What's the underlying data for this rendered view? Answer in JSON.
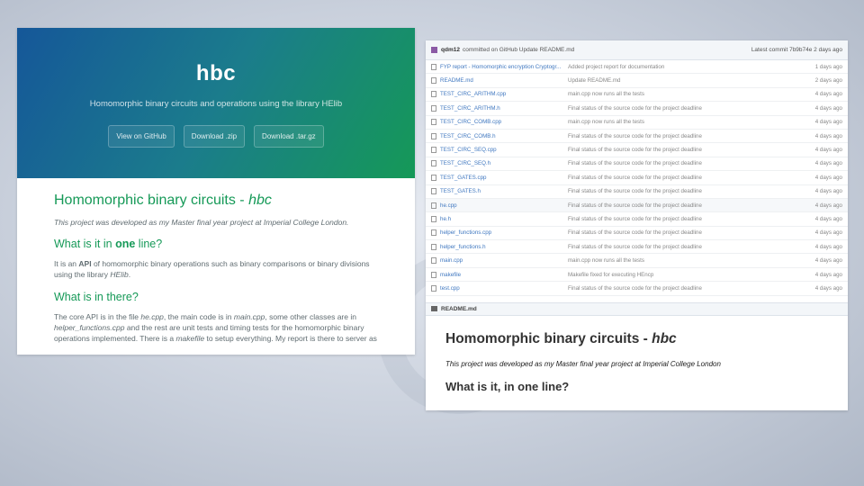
{
  "left": {
    "hero": {
      "title": "hbc",
      "tagline": "Homomorphic binary circuits and operations using the library HElib",
      "buttons": [
        "View on GitHub",
        "Download .zip",
        "Download .tar.gz"
      ]
    },
    "content": {
      "heading_main": "Homomorphic binary circuits - ",
      "heading_main_em": "hbc",
      "intro": "This project was developed as my Master final year project at Imperial College London.",
      "h2_one_pre": "What is it in ",
      "h2_one_bold": "one",
      "h2_one_post": " line?",
      "p1_pre": "It is an ",
      "p1_bold": "API",
      "p1_mid": " of homomorphic binary operations such as binary comparisons or binary divisions using the library ",
      "p1_em": "HElib",
      "p1_end": ".",
      "h2_two": "What is in there?",
      "p2_a": "The core API is in the file ",
      "p2_b": "he.cpp",
      "p2_c": ", the main code is in ",
      "p2_d": "main.cpp",
      "p2_e": ", some other classes are in ",
      "p2_f": "helper_functions.cpp",
      "p2_g": " and the rest are unit tests and timing tests for the homomorphic binary operations implemented. There is a ",
      "p2_h": "makefile",
      "p2_i": " to setup everything. My report is there to server as"
    }
  },
  "right": {
    "commit": {
      "user": "qdm12",
      "text": "committed on GitHub Update README.md",
      "latest": "Latest commit 7b9b74e 2 days ago"
    },
    "files": [
      {
        "name": "FYP report - Homomorphic encryption Cryptogr...",
        "msg": "Added project report for documentation",
        "age": "1 days ago"
      },
      {
        "name": "README.md",
        "msg": "Update README.md",
        "age": "2 days ago"
      },
      {
        "name": "TEST_CIRC_ARITHM.cpp",
        "msg": "main.cpp now runs all the tests",
        "age": "4 days ago"
      },
      {
        "name": "TEST_CIRC_ARITHM.h",
        "msg": "Final status of the source code for the project deadline",
        "age": "4 days ago"
      },
      {
        "name": "TEST_CIRC_COMB.cpp",
        "msg": "main.cpp now runs all the tests",
        "age": "4 days ago"
      },
      {
        "name": "TEST_CIRC_COMB.h",
        "msg": "Final status of the source code for the project deadline",
        "age": "4 days ago"
      },
      {
        "name": "TEST_CIRC_SEQ.cpp",
        "msg": "Final status of the source code for the project deadline",
        "age": "4 days ago"
      },
      {
        "name": "TEST_CIRC_SEQ.h",
        "msg": "Final status of the source code for the project deadline",
        "age": "4 days ago"
      },
      {
        "name": "TEST_GATES.cpp",
        "msg": "Final status of the source code for the project deadline",
        "age": "4 days ago"
      },
      {
        "name": "TEST_GATES.h",
        "msg": "Final status of the source code for the project deadline",
        "age": "4 days ago"
      },
      {
        "name": "he.cpp",
        "msg": "Final status of the source code for the project deadline",
        "age": "4 days ago"
      },
      {
        "name": "he.h",
        "msg": "Final status of the source code for the project deadline",
        "age": "4 days ago"
      },
      {
        "name": "helper_functions.cpp",
        "msg": "Final status of the source code for the project deadline",
        "age": "4 days ago"
      },
      {
        "name": "helper_functions.h",
        "msg": "Final status of the source code for the project deadline",
        "age": "4 days ago"
      },
      {
        "name": "main.cpp",
        "msg": "main.cpp now runs all the tests",
        "age": "4 days ago"
      },
      {
        "name": "makefile",
        "msg": "Makefile fixed for executing HEncp",
        "age": "4 days ago"
      },
      {
        "name": "test.cpp",
        "msg": "Final status of the source code for the project deadline",
        "age": "4 days ago"
      }
    ],
    "readme": {
      "bar_label": "README.md",
      "h1": "Homomorphic binary circuits - ",
      "h1_em": "hbc",
      "intro": "This project was developed as my Master final year project at Imperial College London",
      "h2_pre": "What is it, in ",
      "h2_bold": "one",
      "h2_post": " line?"
    }
  }
}
